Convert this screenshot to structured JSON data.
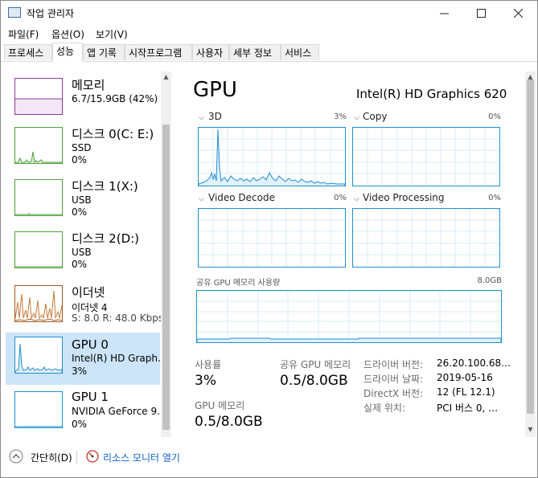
{
  "window": {
    "title": "작업 관리자",
    "controls": [
      "minimize",
      "maximize",
      "close"
    ]
  },
  "menu": [
    "파일(F)",
    "옵션(O)",
    "보기(V)"
  ],
  "tabs": [
    "프로세스",
    "성능",
    "앱 기록",
    "시작프로그램",
    "사용자",
    "세부 정보",
    "서비스"
  ],
  "active_tab": "성능",
  "sidebar": [
    {
      "title": "메모리",
      "line1": "6.7/15.9GB (42%)",
      "line2": "",
      "color": "#8b3e9c"
    },
    {
      "title": "디스크 0(C: E:)",
      "line1": "SSD",
      "line2": "0%",
      "color": "#4da03a"
    },
    {
      "title": "디스크 1(X:)",
      "line1": "USB",
      "line2": "0%",
      "color": "#4da03a"
    },
    {
      "title": "디스크 2(D:)",
      "line1": "USB",
      "line2": "0%",
      "color": "#4da03a"
    },
    {
      "title": "이더넷",
      "line1": "이더넷 4",
      "line2": "S: 8.0  R: 48.0 Kbps",
      "color": "#a65a1e"
    },
    {
      "title": "GPU 0",
      "line1": "Intel(R) HD Graph…",
      "line2": "3%",
      "color": "#1e8fd1"
    },
    {
      "title": "GPU 1",
      "line1": "NVIDIA GeForce 9…",
      "line2": "0%",
      "color": "#1e8fd1"
    }
  ],
  "selected_index": 5,
  "detail": {
    "heading": "GPU",
    "device_name": "Intel(R) HD Graphics 620",
    "engines": [
      {
        "name": "3D",
        "pct": "3%"
      },
      {
        "name": "Copy",
        "pct": "0%"
      },
      {
        "name": "Video Decode",
        "pct": "0%"
      },
      {
        "name": "Video Processing",
        "pct": "0%"
      }
    ],
    "shared_memory": {
      "label": "공유 GPU 메모리 사용량",
      "max": "8.0GB"
    },
    "stats": {
      "utilization_label": "사용률",
      "utilization": "3%",
      "shared_label": "공유 GPU 메모리",
      "shared": "0.5/8.0GB",
      "gpu_mem_label": "GPU 메모리",
      "gpu_mem": "0.5/8.0GB"
    },
    "info": [
      {
        "label": "드라이버 버전:",
        "value": "26.20.100.68…"
      },
      {
        "label": "드라이버 날짜:",
        "value": "2019-05-16"
      },
      {
        "label": "DirectX 버전:",
        "value": "12 (FL 12.1)"
      },
      {
        "label": "실제 위치:",
        "value": "PCI 버스 0, …"
      }
    ]
  },
  "footer": {
    "fewer_details": "간단히(D)",
    "resource_monitor": "리소스 모니터 열기"
  },
  "colors": {
    "accent": "#1e8fd1",
    "selected_bg": "#cce4f7",
    "link": "#0b63c4"
  }
}
